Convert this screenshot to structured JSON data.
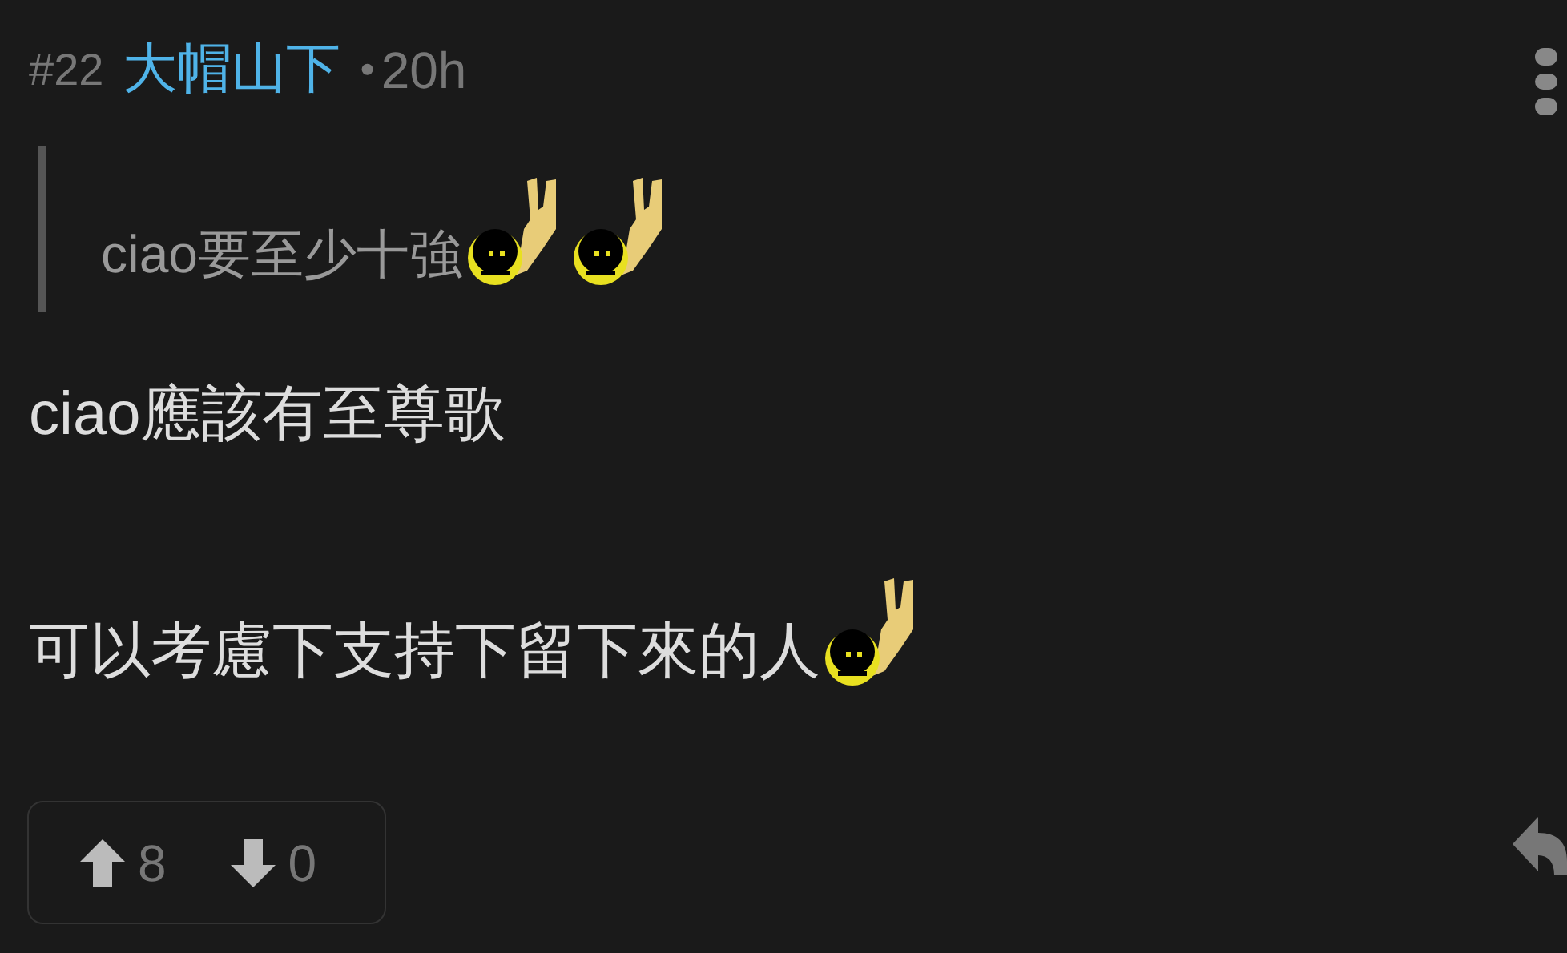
{
  "post": {
    "number": "#22",
    "author": "大帽山下",
    "separator": "•",
    "time": "20h"
  },
  "quote": [
    {
      "kind": "text",
      "text": "ciao要至少十強"
    },
    {
      "kind": "emoji"
    },
    {
      "kind": "emoji"
    }
  ],
  "paragraphs": [
    [
      {
        "kind": "text",
        "text": "ciao應該有至尊歌"
      }
    ],
    [
      {
        "kind": "text",
        "text": "可以考慮下支持下留下來的人"
      },
      {
        "kind": "emoji"
      }
    ]
  ],
  "votes": {
    "up": "8",
    "down": "0"
  }
}
